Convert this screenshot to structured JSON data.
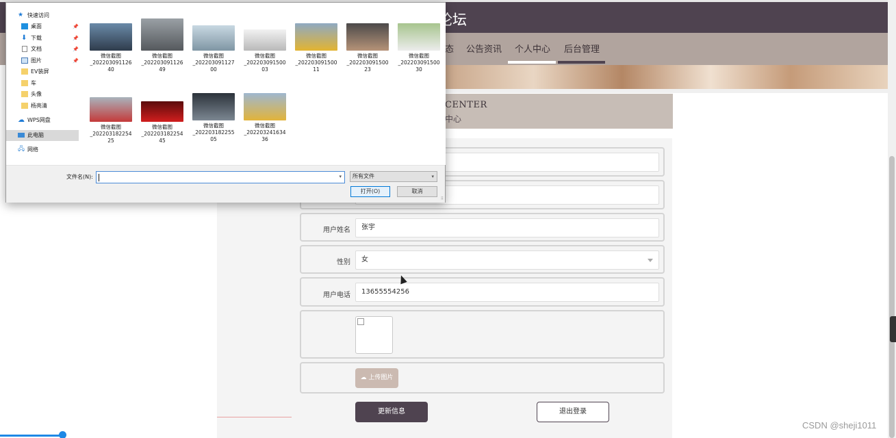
{
  "site": {
    "title": "论坛",
    "nav": [
      {
        "label": "态",
        "active": false
      },
      {
        "label": "公告资讯",
        "active": false
      },
      {
        "label": "个人中心",
        "active": true
      },
      {
        "label": "后台管理",
        "active": false
      }
    ],
    "center_title_en": "CENTER",
    "center_title_cn": "中心"
  },
  "form": {
    "rows": [
      {
        "label": "",
        "value": ""
      },
      {
        "label": "",
        "value": ""
      },
      {
        "label": "用户姓名",
        "value": "张宇"
      },
      {
        "label": "性别",
        "value": "女"
      },
      {
        "label": "用户电话",
        "value": "13655554256"
      }
    ],
    "upload_label": "上传图片",
    "update_label": "更新信息",
    "logout_label": "退出登录"
  },
  "dialog": {
    "nav_items": [
      {
        "label": "快速访问",
        "icon": "star-icon",
        "pinned": false
      },
      {
        "label": "桌面",
        "icon": "desktop-icon",
        "pinned": true
      },
      {
        "label": "下载",
        "icon": "download-icon",
        "pinned": true
      },
      {
        "label": "文档",
        "icon": "document-icon",
        "pinned": true
      },
      {
        "label": "图片",
        "icon": "pictures-icon",
        "pinned": true
      },
      {
        "label": "EV装屏",
        "icon": "folder-icon",
        "pinned": false
      },
      {
        "label": "车",
        "icon": "folder-icon",
        "pinned": false
      },
      {
        "label": "头像",
        "icon": "folder-icon",
        "pinned": false
      },
      {
        "label": "杨亮清",
        "icon": "folder-icon",
        "pinned": false
      },
      {
        "label": "WPS网盘",
        "icon": "cloud-icon",
        "pinned": false
      },
      {
        "label": "此电脑",
        "icon": "computer-icon",
        "pinned": false,
        "selected": true
      },
      {
        "label": "网络",
        "icon": "network-icon",
        "pinned": false
      }
    ],
    "files": [
      {
        "name1": "微信截图",
        "name2": "_202203091126",
        "name3": "40",
        "thumb": "#3a4a5e"
      },
      {
        "name1": "微信截图",
        "name2": "_202203091126",
        "name3": "49",
        "thumb": "#7d8287"
      },
      {
        "name1": "微信截图",
        "name2": "_202203091127",
        "name3": "00",
        "thumb": "#9fb3bf"
      },
      {
        "name1": "微信截图",
        "name2": "_202203091500",
        "name3": "03",
        "thumb": "#d9d9d9"
      },
      {
        "name1": "微信截图",
        "name2": "_202203091500",
        "name3": "11",
        "thumb": "#d9a521"
      },
      {
        "name1": "微信截图",
        "name2": "_202203091500",
        "name3": "23",
        "thumb": "#9a8270"
      },
      {
        "name1": "微信截图",
        "name2": "_202203091500",
        "name3": "30",
        "thumb": "#7aa66a"
      },
      {
        "name1": "微信截图",
        "name2": "_202203182254",
        "name3": "25",
        "thumb": "#c43a3a"
      },
      {
        "name1": "微信截图",
        "name2": "_202203182254",
        "name3": "45",
        "thumb": "#b81818"
      },
      {
        "name1": "微信截图",
        "name2": "_202203182255",
        "name3": "05",
        "thumb": "#4e5a66"
      },
      {
        "name1": "微信截图",
        "name2": "_202203241634",
        "name3": "36",
        "thumb": "#e0b53a"
      }
    ],
    "filename_label": "文件名(N):",
    "filename_value": "",
    "filetype": "所有文件",
    "open_label": "打开(O)",
    "cancel_label": "取消"
  },
  "watermark": "CSDN @sheji1011",
  "colors": {
    "header": "#4f4350",
    "nav": "#b1a49e",
    "accent": "#cbbab1",
    "dialog_focus": "#0078d7"
  }
}
